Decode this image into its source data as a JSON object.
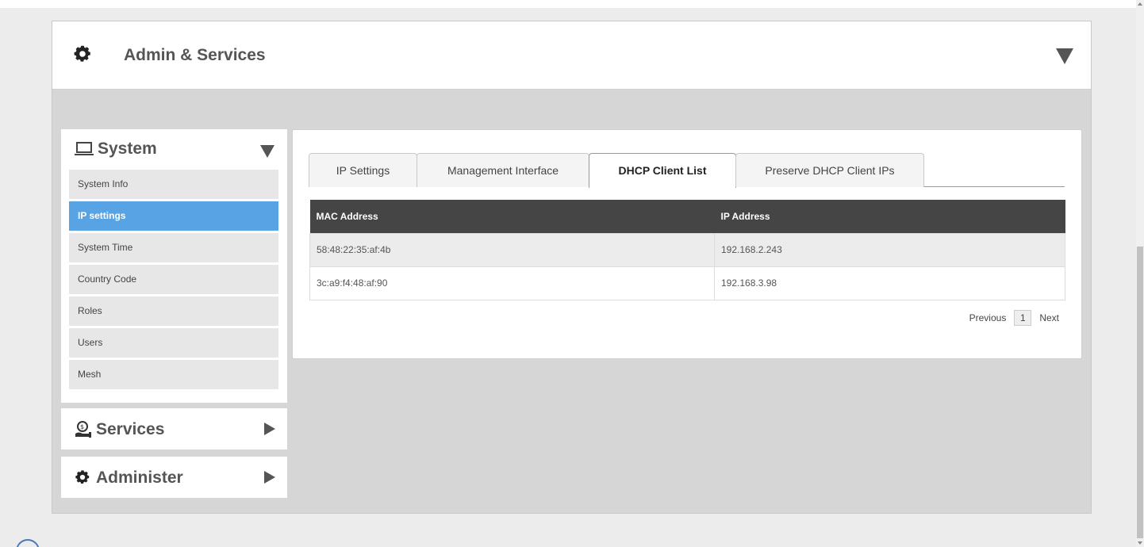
{
  "header": {
    "title": "Admin & Services"
  },
  "sidebar": {
    "system": {
      "label": "System",
      "items": [
        {
          "label": "System Info"
        },
        {
          "label": "IP settings"
        },
        {
          "label": "System Time"
        },
        {
          "label": "Country Code"
        },
        {
          "label": "Roles"
        },
        {
          "label": "Users"
        },
        {
          "label": "Mesh"
        }
      ],
      "active_item": "IP settings"
    },
    "services": {
      "label": "Services"
    },
    "administer": {
      "label": "Administer"
    }
  },
  "tabs": [
    {
      "label": "IP Settings"
    },
    {
      "label": "Management Interface"
    },
    {
      "label": "DHCP Client List"
    },
    {
      "label": "Preserve DHCP Client IPs"
    }
  ],
  "active_tab": "DHCP Client List",
  "table": {
    "columns": [
      "MAC Address",
      "IP Address"
    ],
    "rows": [
      [
        "58:48:22:35:af:4b",
        "192.168.2.243"
      ],
      [
        "3c:a9:f4:48:af:90",
        "192.168.3.98"
      ]
    ]
  },
  "pager": {
    "previous": "Previous",
    "page": "1",
    "next": "Next"
  },
  "colors": {
    "active_nav": "#58a3e3",
    "table_header": "#454545",
    "panel_bg": "#d6d6d6"
  },
  "icons": {
    "header": "gear-icon",
    "system": "laptop-icon",
    "services": "services-icon",
    "administer": "gear-icon"
  }
}
